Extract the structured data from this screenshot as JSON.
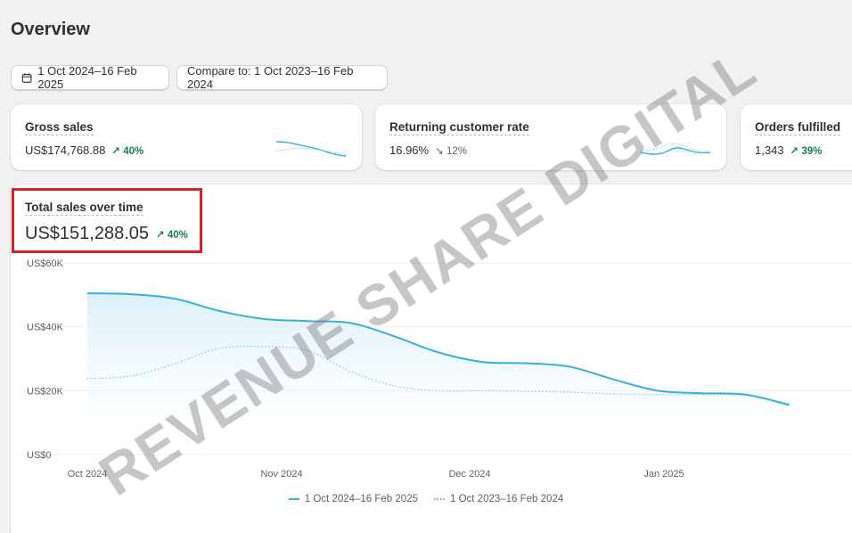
{
  "page": {
    "title": "Overview"
  },
  "filters": {
    "date_range": "1 Oct 2024–16 Feb 2025",
    "compare": "Compare to: 1 Oct 2023–16 Feb 2024"
  },
  "metrics": [
    {
      "label": "Gross sales",
      "value": "US$174,768.88",
      "trend": "40%",
      "direction": "up"
    },
    {
      "label": "Returning customer rate",
      "value": "16.96%",
      "trend": "12%",
      "direction": "down"
    },
    {
      "label": "Orders fulfilled",
      "value": "1,343",
      "trend": "39%",
      "direction": "up"
    }
  ],
  "chart": {
    "title": "Total sales over time",
    "value": "US$151,288.05",
    "trend": "40%",
    "legend": [
      "1 Oct 2024–16 Feb 2025",
      "1 Oct 2023–16 Feb 2024"
    ]
  },
  "watermark": "REVENUE SHARE DIGITAL",
  "colors": {
    "primary_series": "#38b0d8",
    "comparison_series": "#7ccbe4",
    "trend_up": "#1a7f4b",
    "highlight": "#d82128"
  },
  "chart_data": {
    "type": "line",
    "x": [
      "2024-10-01",
      "2024-10-08",
      "2024-10-15",
      "2024-10-22",
      "2024-10-29",
      "2024-11-05",
      "2024-11-12",
      "2024-11-19",
      "2024-11-26",
      "2024-12-03",
      "2024-12-10",
      "2024-12-17",
      "2024-12-24",
      "2024-12-31",
      "2025-01-07",
      "2025-01-14",
      "2025-01-21"
    ],
    "x_ticks": [
      "Oct 2024",
      "Nov 2024",
      "Dec 2024",
      "Jan 2025"
    ],
    "y_ticks": [
      "US$0",
      "US$20K",
      "US$40K",
      "US$60K"
    ],
    "ylim": [
      0,
      60000
    ],
    "series": [
      {
        "name": "1 Oct 2024–16 Feb 2025",
        "style": "solid",
        "values": [
          50500,
          50200,
          48800,
          45000,
          42500,
          41800,
          41200,
          37000,
          32000,
          29000,
          28600,
          27500,
          23500,
          20000,
          19200,
          18800,
          15500
        ]
      },
      {
        "name": "1 Oct 2023–16 Feb 2024",
        "style": "dotted",
        "values": [
          23800,
          24600,
          28500,
          33200,
          33800,
          32600,
          26000,
          21500,
          20000,
          20000,
          19800,
          19500,
          19000,
          18800,
          18800,
          18500,
          16000
        ]
      }
    ],
    "grid": true,
    "legend_position": "bottom-center"
  }
}
